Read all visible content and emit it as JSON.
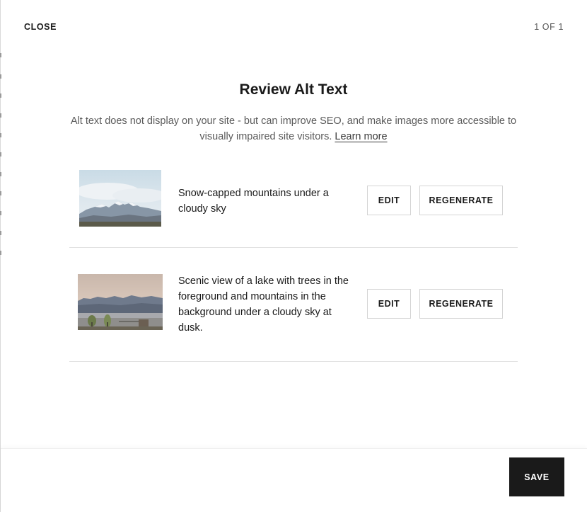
{
  "header": {
    "close_label": "CLOSE",
    "pager_text": "1 OF 1"
  },
  "dialog": {
    "title": "Review Alt Text",
    "description": "Alt text does not display on your site - but can improve SEO, and make images more accessible to visually impaired site visitors.",
    "learn_more_label": "Learn more"
  },
  "images": [
    {
      "alt_text": "Snow-capped mountains under a cloudy sky",
      "edit_label": "EDIT",
      "regenerate_label": "REGENERATE"
    },
    {
      "alt_text": "Scenic view of a lake with trees in the foreground and mountains in the background under a cloudy sky at dusk.",
      "edit_label": "EDIT",
      "regenerate_label": "REGENERATE"
    }
  ],
  "footer": {
    "save_label": "SAVE"
  },
  "colors": {
    "primary_button": "#1a1a1a",
    "border": "#d4d4d4",
    "divider": "#e2e2e2",
    "muted_text": "#5a5a5a"
  }
}
